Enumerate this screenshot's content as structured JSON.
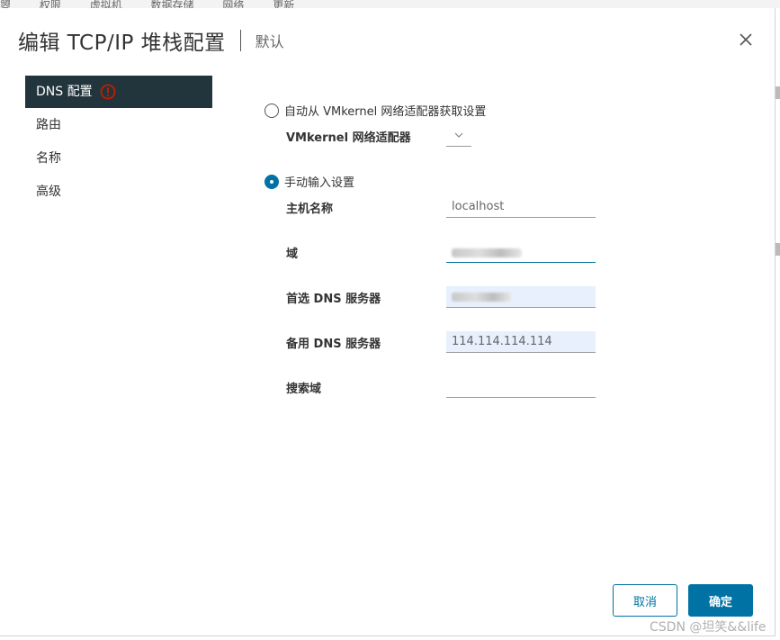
{
  "background": {
    "tabs": [
      "曌",
      "权限",
      "虚拟机",
      "数据存储",
      "网络",
      "更新"
    ]
  },
  "dialog": {
    "title": "编辑 TCP/IP 堆栈配置",
    "subtitle": "默认",
    "close_icon": "close-icon"
  },
  "sidebar": {
    "items": [
      {
        "label": "DNS 配置",
        "active": true,
        "icon": "error-icon"
      },
      {
        "label": "路由"
      },
      {
        "label": "名称"
      },
      {
        "label": "高级"
      }
    ]
  },
  "form": {
    "auto_option": {
      "label": "自动从 VMkernel 网络适配器获取设置",
      "checked": false
    },
    "adapter_label": "VMkernel 网络适配器",
    "manual_option": {
      "label": "手动输入设置",
      "checked": true
    },
    "hostname": {
      "label": "主机名称",
      "value": "localhost"
    },
    "domain": {
      "label": "域"
    },
    "preferred_dns": {
      "label": "首选 DNS 服务器"
    },
    "alternate_dns": {
      "label": "备用 DNS 服务器",
      "value": "114.114.114.114"
    },
    "search_domain": {
      "label": "搜索域",
      "value": ""
    }
  },
  "footer": {
    "cancel_label": "取消",
    "ok_label": "确定"
  },
  "watermark": "CSDN @坦笑&&life",
  "colors": {
    "accent": "#0072a3",
    "sidebar_active": "#22343c",
    "error": "#c21d00"
  }
}
